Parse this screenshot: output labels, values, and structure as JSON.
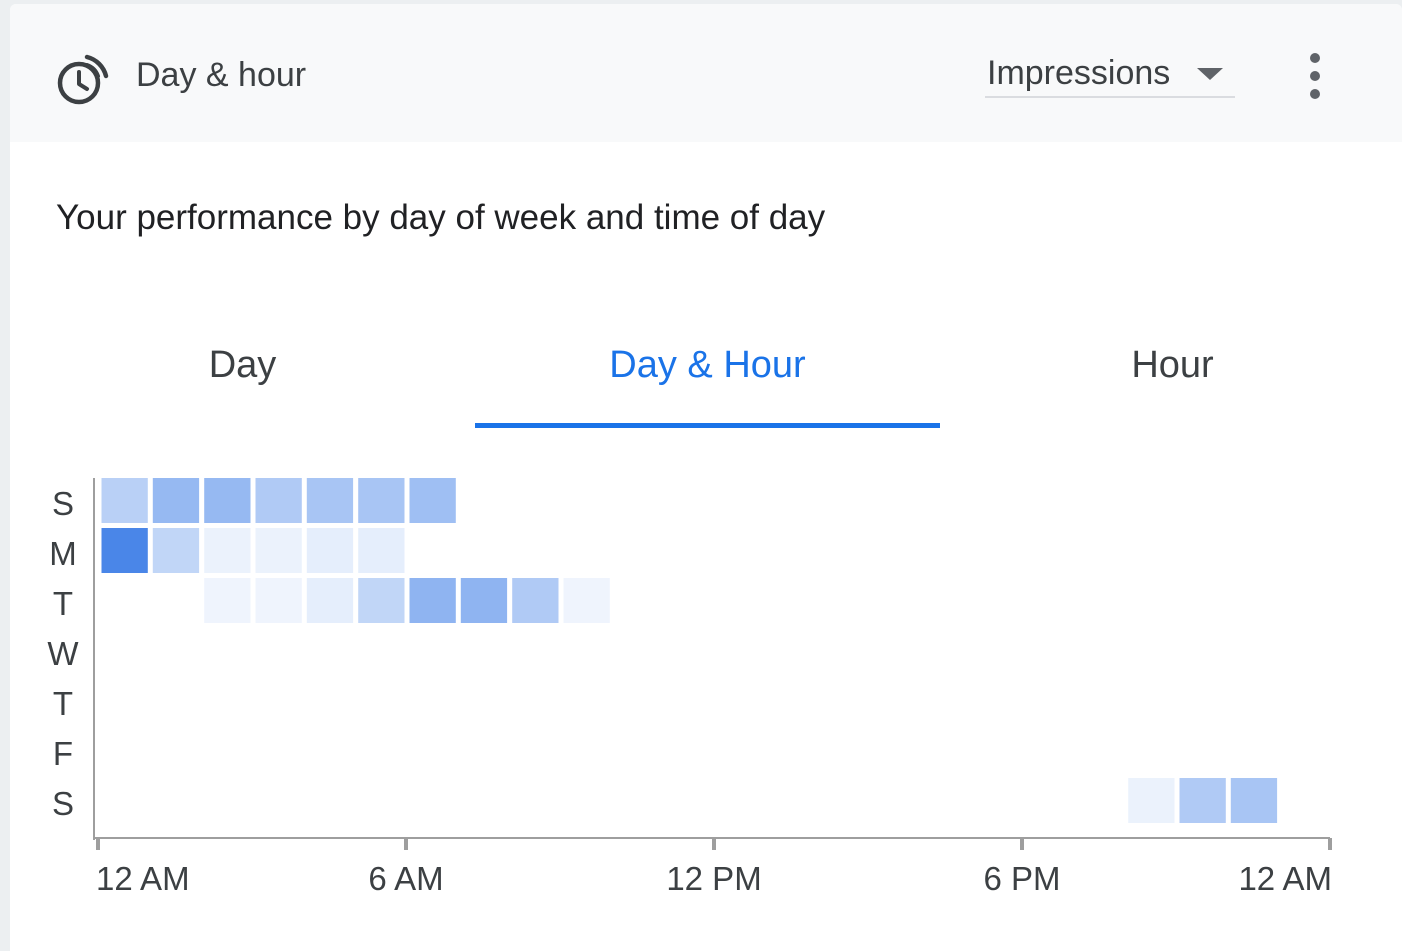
{
  "header": {
    "title": "Day & hour",
    "icon": "schedule-clock-icon",
    "metric_selector": {
      "selected": "Impressions",
      "icon": "arrow-drop-down-icon"
    },
    "more_icon": "more-vert-icon"
  },
  "subtitle": "Your performance by day of week and time of day",
  "tabs": [
    {
      "label": "Day",
      "active": false
    },
    {
      "label": "Day & Hour",
      "active": true
    },
    {
      "label": "Hour",
      "active": false
    }
  ],
  "colors": {
    "accent": "#1a73e8",
    "cell_base": "#4a86e8",
    "axis": "#9e9e9e"
  },
  "chart_data": {
    "type": "heatmap",
    "y_categories": [
      "S",
      "M",
      "T",
      "W",
      "T",
      "F",
      "S"
    ],
    "x_tick_labels": [
      "12 AM",
      "6 AM",
      "12 PM",
      "6 PM",
      "12 AM"
    ],
    "x_range": [
      0,
      24
    ],
    "value_scale": "relative intensity 0-1",
    "rows": [
      [
        0.35,
        0.55,
        0.55,
        0.4,
        0.45,
        0.45,
        0.5,
        0,
        0,
        0,
        0,
        0,
        0,
        0,
        0,
        0,
        0,
        0,
        0,
        0,
        0,
        0,
        0,
        0
      ],
      [
        1.0,
        0.3,
        0.05,
        0.05,
        0.08,
        0.08,
        0,
        0,
        0,
        0,
        0,
        0,
        0,
        0,
        0,
        0,
        0,
        0,
        0,
        0,
        0,
        0,
        0,
        0
      ],
      [
        0,
        0,
        0.03,
        0.03,
        0.08,
        0.3,
        0.6,
        0.6,
        0.4,
        0.03,
        0,
        0,
        0,
        0,
        0,
        0,
        0,
        0,
        0,
        0,
        0,
        0,
        0,
        0
      ],
      [
        0,
        0,
        0,
        0,
        0,
        0,
        0,
        0,
        0,
        0,
        0,
        0,
        0,
        0,
        0,
        0,
        0,
        0,
        0,
        0,
        0,
        0,
        0,
        0
      ],
      [
        0,
        0,
        0,
        0,
        0,
        0,
        0,
        0,
        0,
        0,
        0,
        0,
        0,
        0,
        0,
        0,
        0,
        0,
        0,
        0,
        0,
        0,
        0,
        0
      ],
      [
        0,
        0,
        0,
        0,
        0,
        0,
        0,
        0,
        0,
        0,
        0,
        0,
        0,
        0,
        0,
        0,
        0,
        0,
        0,
        0,
        0,
        0,
        0,
        0
      ],
      [
        0,
        0,
        0,
        0,
        0,
        0,
        0,
        0,
        0,
        0,
        0,
        0,
        0,
        0,
        0,
        0,
        0,
        0,
        0,
        0,
        0.05,
        0.4,
        0.45,
        0
      ]
    ]
  }
}
